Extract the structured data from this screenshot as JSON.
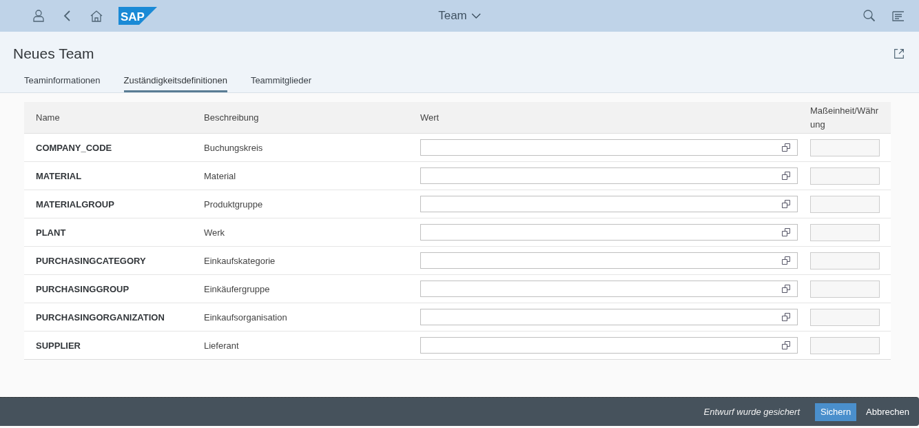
{
  "shell": {
    "logo": "SAP",
    "title": "Team"
  },
  "page": {
    "title": "Neues Team"
  },
  "tabs": [
    {
      "label": "Teaminformationen",
      "selected": false
    },
    {
      "label": "Zuständigkeitsdefinitionen",
      "selected": true
    },
    {
      "label": "Teammitglieder",
      "selected": false
    }
  ],
  "table": {
    "columns": [
      "Name",
      "Beschreibung",
      "Wert",
      "Maßeinheit/Währung"
    ],
    "rows": [
      {
        "name": "COMPANY_CODE",
        "description": "Buchungskreis"
      },
      {
        "name": "MATERIAL",
        "description": "Material"
      },
      {
        "name": "MATERIALGROUP",
        "description": "Produktgruppe"
      },
      {
        "name": "PLANT",
        "description": "Werk"
      },
      {
        "name": "PURCHASINGCATEGORY",
        "description": "Einkaufskategorie"
      },
      {
        "name": "PURCHASINGGROUP",
        "description": "Einkäufergruppe"
      },
      {
        "name": "PURCHASINGORGANIZATION",
        "description": "Einkaufsorganisation"
      },
      {
        "name": "SUPPLIER",
        "description": "Lieferant"
      }
    ]
  },
  "footer": {
    "message": "Entwurf wurde gesichert",
    "buttons": [
      {
        "label": "Sichern",
        "kind": "primary"
      },
      {
        "label": "Abbrechen",
        "kind": "plain"
      }
    ]
  }
}
